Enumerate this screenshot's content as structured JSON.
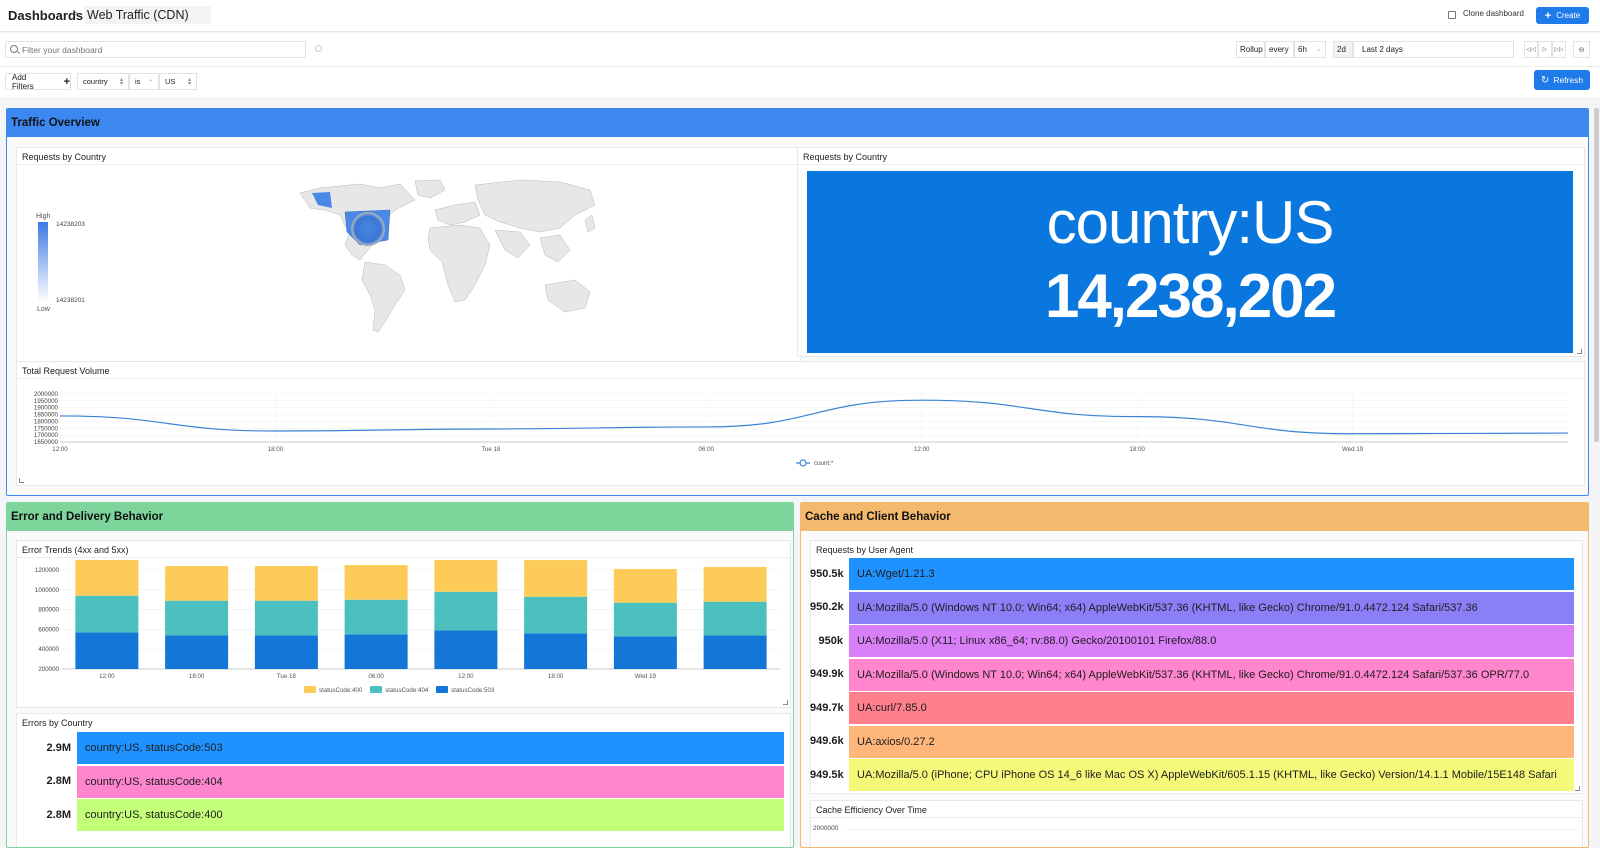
{
  "header": {
    "breadcrumb_root": "Dashboards",
    "breadcrumb_sep": ">",
    "dashboard_name": "Web Traffic (CDN)",
    "clone_label": "Clone dashboard",
    "create_label": "Create"
  },
  "toolbar": {
    "search_placeholder": "Filter your dashboard",
    "rollup_label": "Rollup",
    "every_label": "every",
    "rollup_value": "6h",
    "range_short": "2d",
    "range_label": "Last 2 days"
  },
  "filters": {
    "add_label": "Add Filters",
    "field": "country",
    "operator": "is",
    "value": "US",
    "refresh_label": "Refresh"
  },
  "sections": {
    "traffic": {
      "title": "Traffic Overview",
      "color": "#3d87f0"
    },
    "errors": {
      "title": "Error and Delivery Behavior",
      "color": "#7dd59b"
    },
    "cache": {
      "title": "Cache and Client Behavior",
      "color": "#f4b96c"
    }
  },
  "panels": {
    "map": {
      "title": "Requests by Country",
      "legend_high": "High",
      "legend_low": "Low",
      "max_value": "14238203",
      "min_value": "14238201"
    },
    "stat": {
      "title": "Requests by Country",
      "line1": "country:US",
      "line2": "14,238,202",
      "color": "#0a77df"
    },
    "volume": {
      "title": "Total Request Volume"
    },
    "error_trends": {
      "title": "Error Trends (4xx and 5xx)"
    },
    "errors_country": {
      "title": "Errors by Country"
    },
    "user_agent": {
      "title": "Requests by User Agent"
    },
    "cache_eff": {
      "title": "Cache Efficiency Over Time",
      "y_top": "2000000"
    }
  },
  "chart_data": [
    {
      "type": "line",
      "title": "Total Request Volume",
      "x": [
        "12:00",
        "18:00",
        "Tue 18",
        "06:00",
        "12:00",
        "18:00",
        "Wed 19",
        ""
      ],
      "series": [
        {
          "name": "count:*",
          "values": [
            1840000,
            1730000,
            1745000,
            1760000,
            1955000,
            1835000,
            1710000,
            1715000
          ]
        }
      ],
      "ylim": [
        1650000,
        2000000
      ],
      "yticks": [
        "2000000",
        "1950000",
        "1900000",
        "1850000",
        "1800000",
        "1750000",
        "1700000",
        "1650000"
      ],
      "xticks": [
        "12:00",
        "18:00",
        "Tue 18",
        "06:00",
        "12:00",
        "18:00",
        "Wed 19"
      ],
      "color": "#3b82d6"
    },
    {
      "type": "bar",
      "title": "Error Trends (4xx and 5xx)",
      "categories": [
        "12:00",
        "18:00",
        "Tue 18",
        "06:00",
        "12:00",
        "18:00",
        "Wed 19",
        ""
      ],
      "series": [
        {
          "name": "statusCode:503",
          "color": "#1476d7",
          "values": [
            370000,
            340000,
            340000,
            350000,
            390000,
            360000,
            330000,
            340000
          ]
        },
        {
          "name": "statusCode:404",
          "color": "#4cc0bf",
          "values": [
            370000,
            350000,
            350000,
            350000,
            390000,
            370000,
            340000,
            340000
          ]
        },
        {
          "name": "statusCode:400",
          "color": "#fdcc58",
          "values": [
            370000,
            350000,
            350000,
            350000,
            390000,
            370000,
            340000,
            350000
          ]
        }
      ],
      "ylim": [
        200000,
        1200000
      ],
      "yticks": [
        "1200000",
        "1000000",
        "800000",
        "600000",
        "400000",
        "200000"
      ],
      "xticks": [
        "12:00",
        "18:00",
        "Tue 18",
        "06:00",
        "12:00",
        "18:00",
        "Wed 19"
      ]
    }
  ],
  "errors_by_country": [
    {
      "value": "2.9M",
      "label": "country:US, statusCode:503",
      "color": "#1e93ff"
    },
    {
      "value": "2.8M",
      "label": "country:US, statusCode:404",
      "color": "#ff85cc"
    },
    {
      "value": "2.8M",
      "label": "country:US, statusCode:400",
      "color": "#c4ff7a"
    }
  ],
  "user_agents": [
    {
      "value": "950.5k",
      "label": "UA:Wget/1.21.3",
      "color": "#1e93ff"
    },
    {
      "value": "950.2k",
      "label": "UA:Mozilla/5.0 (Windows NT 10.0; Win64; x64) AppleWebKit/537.36 (KHTML, like Gecko) Chrome/91.0.4472.124 Safari/537.36",
      "color": "#8a7ff7"
    },
    {
      "value": "950k",
      "label": "UA:Mozilla/5.0 (X11; Linux x86_64; rv:88.0) Gecko/20100101 Firefox/88.0",
      "color": "#d97ff7"
    },
    {
      "value": "949.9k",
      "label": "UA:Mozilla/5.0 (Windows NT 10.0; Win64; x64) AppleWebKit/537.36 (KHTML, like Gecko) Chrome/91.0.4472.124 Safari/537.36 OPR/77.0",
      "color": "#ff85cc"
    },
    {
      "value": "949.7k",
      "label": "UA:curl/7.85.0",
      "color": "#ff7f8d"
    },
    {
      "value": "949.6k",
      "label": "UA:axios/0.27.2",
      "color": "#ffb67a"
    },
    {
      "value": "949.5k",
      "label": "UA:Mozilla/5.0 (iPhone; CPU iPhone OS 14_6 like Mac OS X) AppleWebKit/605.1.15 (KHTML, like Gecko) Version/14.1.1 Mobile/15E148 Safari",
      "color": "#f4f97a"
    }
  ]
}
